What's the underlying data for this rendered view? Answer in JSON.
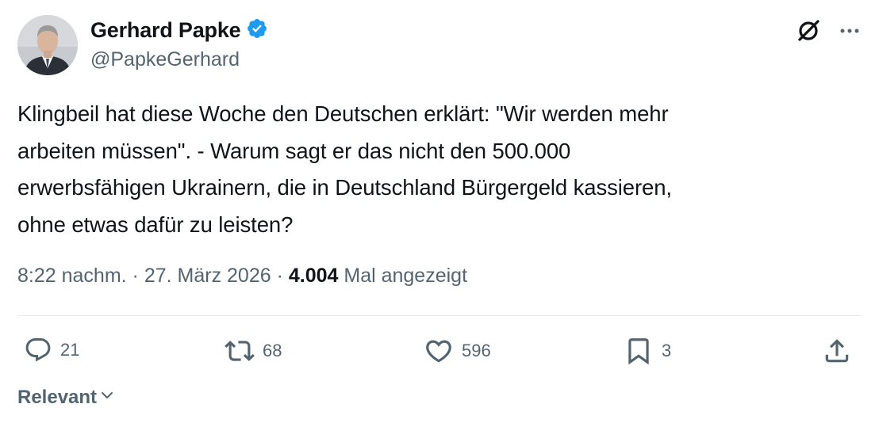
{
  "author": {
    "name": "Gerhard Papke",
    "handle": "@PapkeGerhard",
    "verified_color": "#1d9bf0"
  },
  "tweet": {
    "text": "Klingbeil hat diese Woche den Deutschen erklärt: \"Wir werden mehr\narbeiten müssen\". - Warum sagt er das nicht den 500.000\nerwerbsfähigen Ukrainern, die in Deutschland Bürgergeld kassieren,\nohne etwas dafür zu leisten?"
  },
  "meta": {
    "time": "8:22 nachm.",
    "separator": " · ",
    "date": "27. März 2026",
    "views_count": "4.004",
    "views_label": " Mal angezeigt"
  },
  "actions": {
    "replies": "21",
    "reposts": "68",
    "likes": "596",
    "bookmarks": "3"
  },
  "sort": {
    "label": "Relevant"
  },
  "icons": [
    "grok-icon",
    "more-icon",
    "reply-icon",
    "repost-icon",
    "like-icon",
    "bookmark-icon",
    "share-icon",
    "chevron-down-icon",
    "verified-badge-icon"
  ]
}
